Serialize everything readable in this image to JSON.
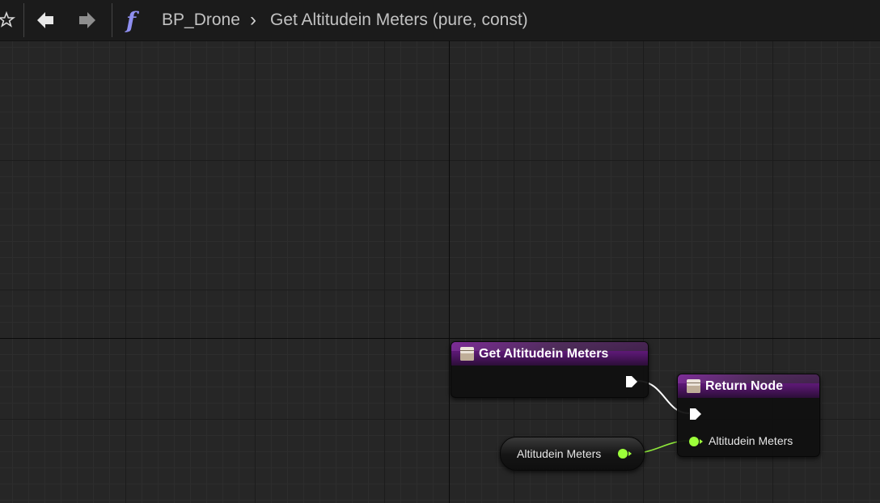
{
  "toolbar": {
    "breadcrumb_blueprint": "BP_Drone",
    "breadcrumb_separator": "›",
    "breadcrumb_function": "Get Altitudein Meters (pure, const)",
    "icons": [
      "star-icon",
      "back-arrow-icon",
      "forward-arrow-icon",
      "function-icon"
    ]
  },
  "nodes": {
    "entry": {
      "title": "Get Altitudein Meters"
    },
    "return": {
      "title": "Return Node",
      "input_label": "Altitudein Meters"
    },
    "variable": {
      "label": "Altitudein Meters"
    }
  },
  "colors": {
    "graph_background": "#262626",
    "node_header": "#5a1872",
    "float_pin": "#9cff3a",
    "exec_pin": "#ffffff"
  }
}
